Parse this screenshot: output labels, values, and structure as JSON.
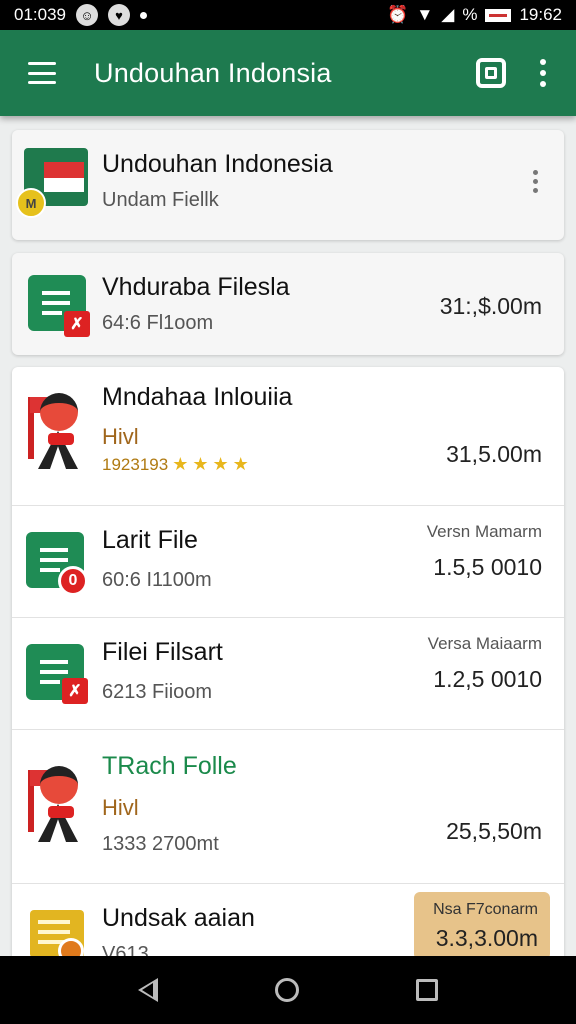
{
  "status_bar": {
    "time_left": "01:039",
    "battery_percent_symbol": "%",
    "clock": "19:62"
  },
  "app_bar": {
    "title": "Undouhan Indonsia"
  },
  "header_card": {
    "title": "Undouhan Indonesia",
    "subtitle": "Undam Fiellk",
    "badge": "M"
  },
  "file_card": {
    "title": "Vhduraba Filesla",
    "subtitle": "64:6 Fl1oom",
    "amount": "31:,$.00m"
  },
  "list": [
    {
      "title": "Mndahaa Inlouiia",
      "hivi": "Hivl",
      "rating_num": "1923193",
      "amount": "31,5.00m"
    },
    {
      "title": "Larit File",
      "subtitle": "60:6 I1100m",
      "version": "Versn Mamarm",
      "amount": "1.5,5 0010",
      "badge": "0"
    },
    {
      "title": "Filei Filsart",
      "subtitle": "6213 Fiioom",
      "version": "Versa Maiaarm",
      "amount": "1.2,5 0010",
      "badge": "✗"
    },
    {
      "title": "TRach Folle",
      "hivi": "Hivl",
      "subtitle": "1333 2700mt",
      "amount": "25,5,50m"
    },
    {
      "title": "Undsak aaian",
      "subtitle": "V613",
      "tag_label": "Nsa F7conarm",
      "tag_amount": "3.3,3.00m"
    }
  ]
}
